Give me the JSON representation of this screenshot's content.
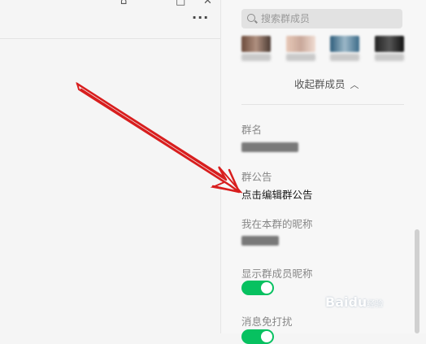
{
  "window": {
    "controls": [
      "⌂",
      "□",
      "✕"
    ],
    "more_label": "···"
  },
  "panel": {
    "search": {
      "placeholder": "搜索群成员"
    },
    "collapse_label": "收起群成员",
    "collapse_icon": "chevron-up",
    "group_name": {
      "label": "群名"
    },
    "announcement": {
      "label": "群公告",
      "value": "点击编辑群公告"
    },
    "nickname": {
      "label": "我在本群的昵称"
    },
    "show_nicknames": {
      "label": "显示群成员昵称",
      "enabled": true
    },
    "mute": {
      "label": "消息免打扰",
      "enabled": true
    }
  },
  "watermark": {
    "brand": "Baidu",
    "suffix": "经验"
  },
  "colors": {
    "accent": "#07c160",
    "arrow": "#d81e1e"
  }
}
